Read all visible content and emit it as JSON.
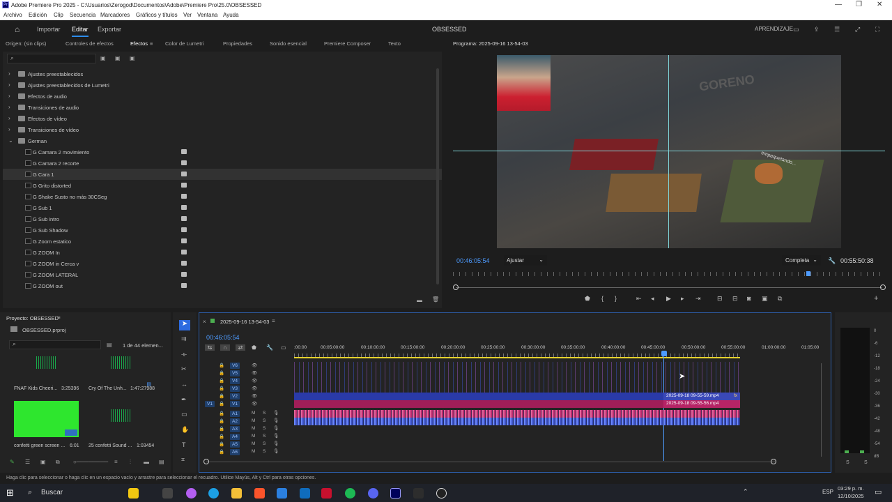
{
  "window": {
    "title": "Adobe Premiere Pro 2025 - C:\\Usuarios\\Zerogod\\Documentos\\Adobe\\Premiere Pro\\25.0\\OBSESSED"
  },
  "menu": [
    "Archivo",
    "Edición",
    "Clip",
    "Secuencia",
    "Marcadores",
    "Gráficos y títulos",
    "Ver",
    "Ventana",
    "Ayuda"
  ],
  "nav": {
    "workspaces": [
      "Importar",
      "Editar",
      "Exportar"
    ],
    "active": "Editar",
    "project_title": "OBSESSED",
    "learn": "APRENDIZAJE"
  },
  "panel_tabs": [
    "Origen: (sin clips)",
    "Controles de efectos",
    "Efectos",
    "Color de Lumetri",
    "Propiedades",
    "Sonido esencial",
    "Premiere Composer",
    "Texto"
  ],
  "effects": {
    "folders": [
      "Ajustes preestablecidos",
      "Ajustes preestablecidos de Lumetri",
      "Efectos de audio",
      "Transiciones de audio",
      "Efectos de vídeo",
      "Transiciones de vídeo",
      "German"
    ],
    "presets": [
      "G Camara 2 movimiento",
      "G Camara 2 recorte",
      "G Cara 1",
      "G Grito distorted",
      "G Shake Susto no más 30CSeg",
      "G Sub 1",
      "G Sub intro",
      "G Sub Shadow",
      "G Zoom estatico",
      "G ZOOM In",
      "G ZOOM in Cerca v",
      "G ZOOM LATERAL",
      "G ZOOM out"
    ],
    "selected": "G Cara 1"
  },
  "program": {
    "title": "Programa: 2025-09-16 13-54-03",
    "timecode": "00:46:05:54",
    "fit": "Ajustar",
    "quality": "Completa",
    "duration": "00:55:50:38",
    "overlay_text_1": "GORENO",
    "overlay_text_2": "empaquetando..."
  },
  "project": {
    "title": "Proyecto: OBSESSED",
    "file": "OBSESSED.prproj",
    "count": "1 de 44 elemen...",
    "items": [
      {
        "name": "FNAF Kids Cheeri...",
        "duration": "3:25396"
      },
      {
        "name": "Cry Of The Unh...",
        "duration": "1:47:27988"
      },
      {
        "name": "confetti green screen ...",
        "duration": "6:01"
      },
      {
        "name": "25 confetti Sound ...",
        "duration": "1:03454"
      }
    ]
  },
  "timeline": {
    "sequence": "2025-09-16 13-54-03",
    "timecode": "00:46:05:54",
    "ruler": [
      ":00:00",
      "00:05:00:00",
      "00:10:00:00",
      "00:15:00:00",
      "00:20:00:00",
      "00:25:00:00",
      "00:30:00:00",
      "00:35:00:00",
      "00:40:00:00",
      "00:45:00:00",
      "00:50:00:00",
      "00:55:00:00",
      "01:00:00:00",
      "01:05:00"
    ],
    "video_tracks": [
      "V6",
      "V5",
      "V4",
      "V3",
      "V2",
      "V1"
    ],
    "audio_tracks": [
      "A1",
      "A2",
      "A3",
      "A4",
      "A5",
      "A6"
    ],
    "clip_v2": "2025-09-18 09-55-59.mp4",
    "clip_v1": "2025-09-18 09-55-56.mp4",
    "fx": "fx",
    "target_v1": "V1"
  },
  "meter": {
    "scale": [
      "0",
      "-6",
      "-12",
      "-18",
      "-24",
      "-30",
      "-36",
      "-42",
      "-48",
      "-54",
      "dB"
    ],
    "solo": [
      "S",
      "S"
    ]
  },
  "status": "Haga clic para seleccionar o haga clic en un espacio vacío y arrastre para seleccionar el recuadro. Utilice Mayús, Alt y Ctrl para otras opciones.",
  "taskbar": {
    "search": "Buscar",
    "lang": "ESP",
    "time": "03:29 p. m.",
    "date": "12/10/2025"
  }
}
